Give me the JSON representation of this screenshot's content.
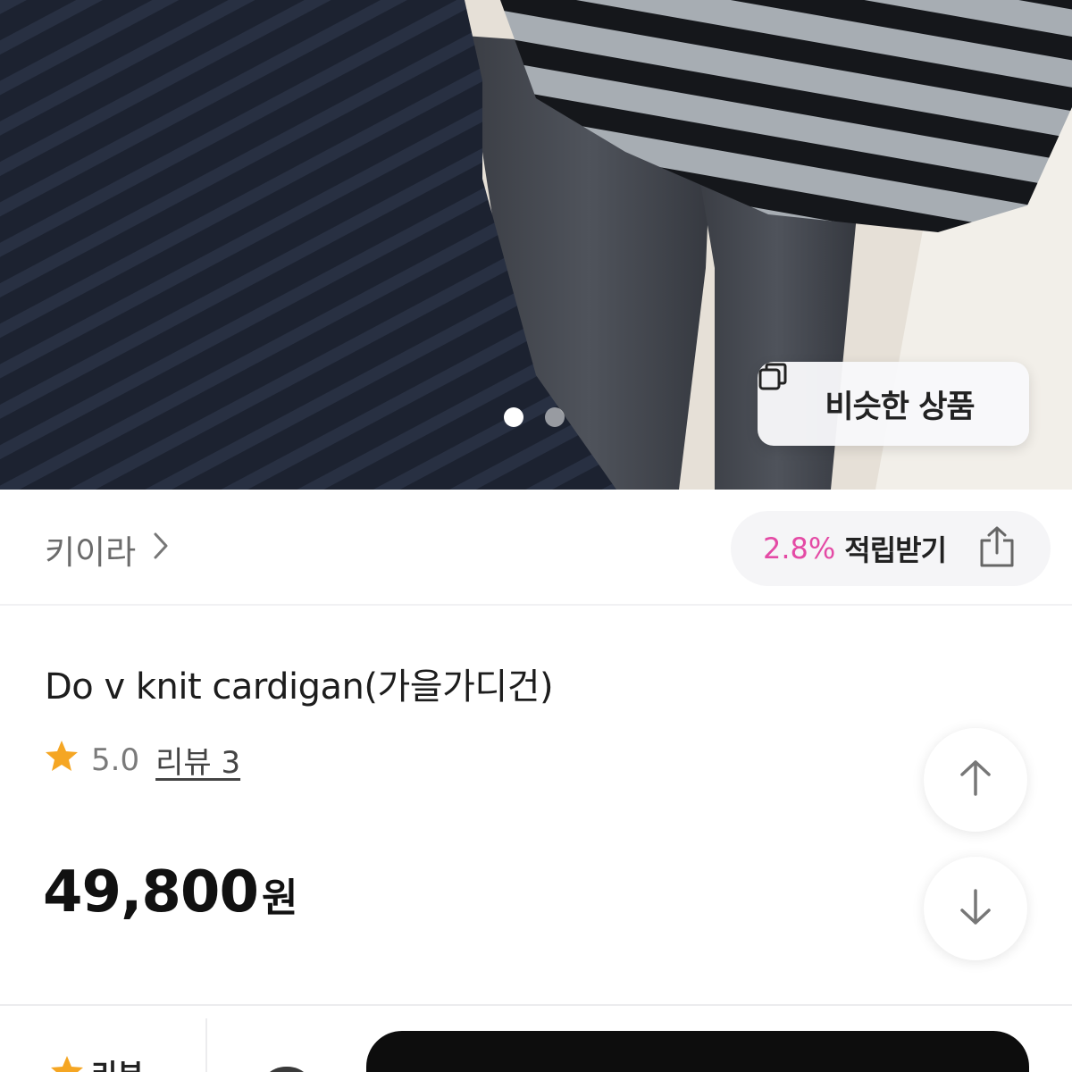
{
  "gallery": {
    "slide_count": 2,
    "active_index": 0,
    "similar_button_label": "비슷한 상품",
    "similar_button_icon": "copy-icon"
  },
  "seller": {
    "name": "키이라",
    "chevron_icon": "chevron-right-icon"
  },
  "points": {
    "rate": "2.8%",
    "label": "적립받기",
    "rate_color": "#e44aa5",
    "share_icon": "share-icon"
  },
  "product": {
    "title": "Do v knit cardigan(가을가디건)",
    "rating": "5.0",
    "rating_icon": "star-icon",
    "rating_color": "#f5a623",
    "reviews_label": "리뷰 3",
    "price": "49,800",
    "currency": "원"
  },
  "floating": {
    "up_icon": "arrow-up-icon",
    "down_icon": "arrow-down-icon"
  },
  "bottom_bar": {
    "review_label": "리뷰",
    "review_icon": "star-icon",
    "wishlist_icon": "heart-icon",
    "buy_button_color": "#0d0d0d"
  }
}
